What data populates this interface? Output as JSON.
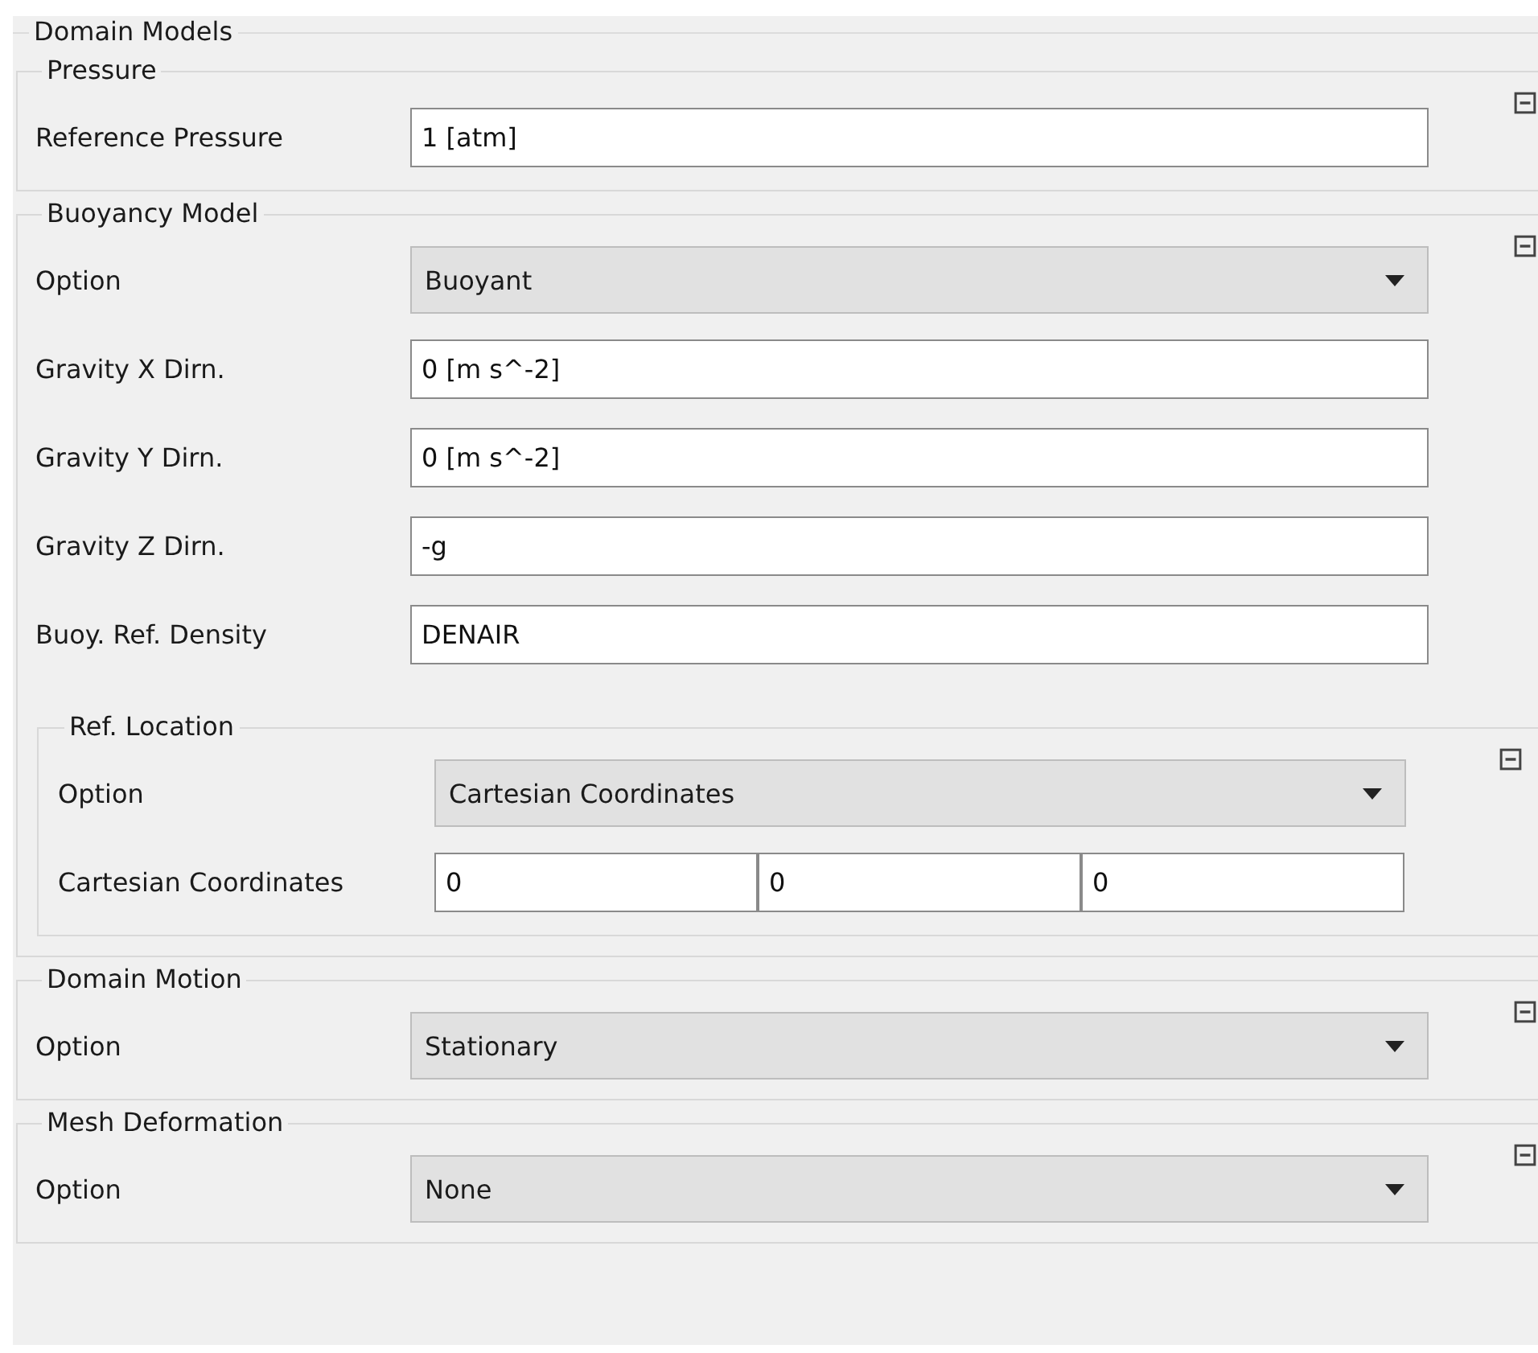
{
  "title": "Domain Models",
  "groups": [
    {
      "title": "Pressure",
      "expanded": true,
      "rows": [
        {
          "kind": "field",
          "label": "Reference Pressure",
          "value": "1 [atm]"
        }
      ]
    },
    {
      "title": "Buoyancy Model",
      "expanded": true,
      "rows": [
        {
          "kind": "dropdown",
          "label": "Option",
          "value": "Buoyant"
        },
        {
          "kind": "field",
          "label": "Gravity X Dirn.",
          "value": "0 [m s^-2]"
        },
        {
          "kind": "field",
          "label": "Gravity Y Dirn.",
          "value": "0 [m s^-2]"
        },
        {
          "kind": "field",
          "label": "Gravity Z Dirn.",
          "value": "-g"
        },
        {
          "kind": "field",
          "label": "Buoy. Ref. Density",
          "value": "DENAIR"
        },
        {
          "kind": "group",
          "title": "Ref. Location",
          "expanded": true,
          "rows": [
            {
              "kind": "dropdown",
              "label": "Option",
              "value": "Cartesian Coordinates"
            },
            {
              "kind": "vector",
              "label": "Cartesian Coordinates",
              "values": [
                "0",
                "0",
                "0"
              ]
            }
          ]
        }
      ]
    },
    {
      "title": "Domain Motion",
      "expanded": true,
      "rows": [
        {
          "kind": "dropdown",
          "label": "Option",
          "value": "Stationary"
        }
      ]
    },
    {
      "title": "Mesh Deformation",
      "expanded": true,
      "rows": [
        {
          "kind": "dropdown",
          "label": "Option",
          "value": "None"
        }
      ]
    }
  ]
}
